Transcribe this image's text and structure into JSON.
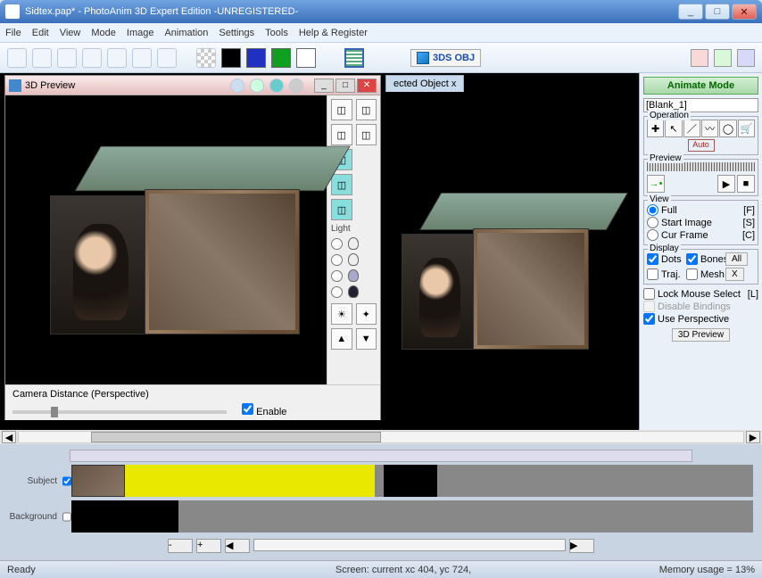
{
  "window": {
    "title": "Sidtex.pap* - PhotoAnim 3D Expert Edition -UNREGISTERED-",
    "minimize": "_",
    "maximize": "□",
    "close": "✕"
  },
  "menu": [
    "File",
    "Edit",
    "View",
    "Mode",
    "Image",
    "Animation",
    "Settings",
    "Tools",
    "Help & Register"
  ],
  "toolbar": {
    "obj_label": "3DS OBJ",
    "swatches": [
      "#000000",
      "#2030c0",
      "#10a020",
      "#ffffff"
    ]
  },
  "preview_window": {
    "title": "3D Preview",
    "light_label": "Light",
    "camera_label": "Camera Distance (Perspective)",
    "enable_label": "Enable"
  },
  "tab": {
    "label": "ected Object x"
  },
  "panel": {
    "mode_button": "Animate Mode",
    "object_name": "[Blank_1]",
    "operation_label": "Operation",
    "auto_label": "Auto",
    "preview_label": "Preview",
    "view_label": "View",
    "view_options": [
      {
        "label": "Full",
        "shortcut": "[F]"
      },
      {
        "label": "Start Image",
        "shortcut": "[S]"
      },
      {
        "label": "Cur Frame",
        "shortcut": "[C]"
      }
    ],
    "display_label": "Display",
    "display_options": [
      {
        "label": "Dots"
      },
      {
        "label": "Bones"
      },
      {
        "label": "All"
      },
      {
        "label": "Traj."
      },
      {
        "label": "Mesh"
      },
      {
        "label": "X"
      }
    ],
    "lock_label": "Lock Mouse Select",
    "lock_shortcut": "[L]",
    "disable_label": "Disable Bindings",
    "perspective_label": "Use Perspective",
    "preview_button": "3D Preview"
  },
  "timeline": {
    "track1": "Subject",
    "track2": "Background",
    "nav_minus": "-",
    "nav_plus": "+"
  },
  "status": {
    "left": "Ready",
    "center": "Screen: current xc 404, yc 724,",
    "right": "Memory usage = 13%"
  }
}
